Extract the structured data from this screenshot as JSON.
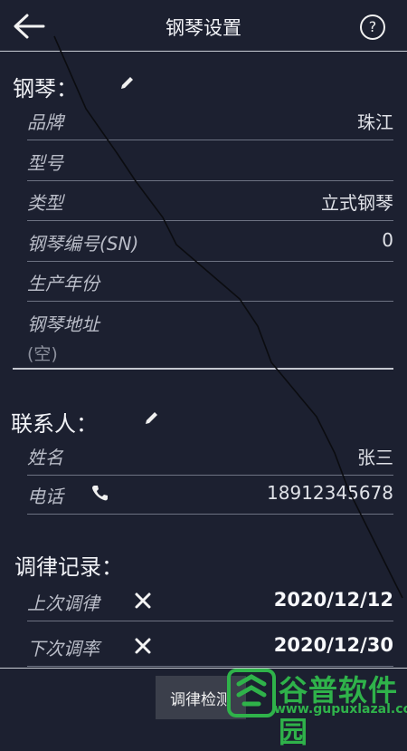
{
  "header": {
    "title": "钢琴设置",
    "help": "?"
  },
  "piano": {
    "section_title": "钢琴：",
    "rows": [
      {
        "label": "品牌",
        "value": "珠江"
      },
      {
        "label": "型号",
        "value": ""
      },
      {
        "label": "类型",
        "value": "立式钢琴"
      },
      {
        "label": "钢琴编号(SN)",
        "value": "0"
      },
      {
        "label": "生产年份",
        "value": ""
      },
      {
        "label": "钢琴地址",
        "value": "(空)"
      }
    ]
  },
  "contact": {
    "section_title": "联系人：",
    "name_label": "姓名",
    "name_value": "张三",
    "phone_label": "电话",
    "phone_value": "18912345678"
  },
  "tuning": {
    "section_title": "调律记录：",
    "last_label": "上次调律",
    "last_value": "2020/12/12",
    "next_label": "下次调率",
    "next_value": "2020/12/30"
  },
  "bottom": {
    "button_label": "调律检测"
  },
  "watermark": {
    "text": "谷普软件园",
    "url": "www.gupuxlazal.com"
  },
  "colors": {
    "background": "#1c2030",
    "watermark": "#2fb24a"
  }
}
